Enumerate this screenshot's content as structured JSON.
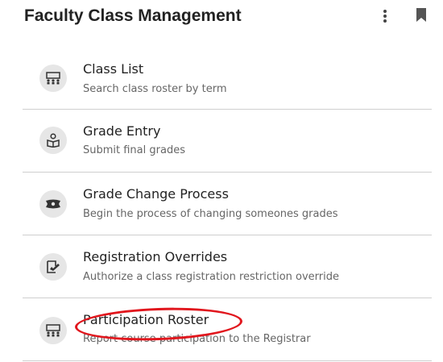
{
  "header": {
    "title": "Faculty Class Management",
    "menu_icon": "kebab-menu-icon",
    "bookmark_icon": "bookmark-icon"
  },
  "items": [
    {
      "title": "Class List",
      "subtitle": "Search class roster by term",
      "icon": "class-roster-icon"
    },
    {
      "title": "Grade Entry",
      "subtitle": "Submit final grades",
      "icon": "grade-entry-icon"
    },
    {
      "title": "Grade Change Process",
      "subtitle": "Begin the process of changing someones grades",
      "icon": "grade-change-icon"
    },
    {
      "title": "Registration Overrides",
      "subtitle": "Authorize a class registration restriction override",
      "icon": "override-icon"
    },
    {
      "title": "Participation Roster",
      "subtitle": "Report course participation to the Registrar",
      "icon": "participation-roster-icon"
    }
  ],
  "colors": {
    "highlight": "#e1161d",
    "icon_bg": "#e6e6e6",
    "divider": "#cfcfcf"
  }
}
